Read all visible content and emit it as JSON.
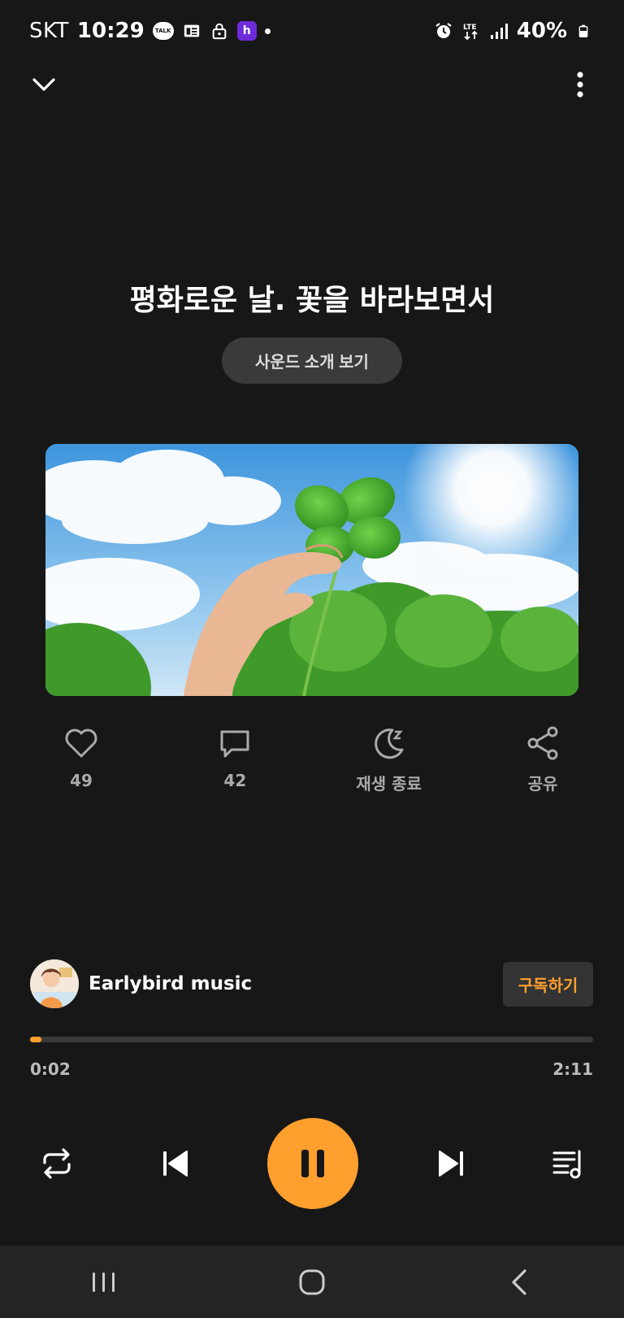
{
  "status_bar": {
    "carrier": "SKT",
    "time": "10:29",
    "talk_badge": "TALK",
    "h_badge": "h",
    "battery": "40%"
  },
  "player": {
    "title": "평화로운 날. 꽃을 바라보면서",
    "intro_button": "사운드 소개 보기",
    "actions": [
      {
        "label": "49",
        "icon": "heart-icon"
      },
      {
        "label": "42",
        "icon": "comment-icon"
      },
      {
        "label": "재생 종료",
        "icon": "sleep-timer-icon"
      },
      {
        "label": "공유",
        "icon": "share-icon"
      }
    ],
    "artist": "Earlybird music",
    "subscribe_label": "구독하기",
    "current_time": "0:02",
    "total_time": "2:11",
    "progress": 0.015
  },
  "colors": {
    "accent": "#ff9f2e",
    "background": "#171717"
  }
}
